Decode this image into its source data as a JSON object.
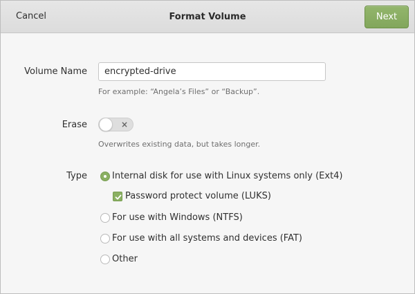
{
  "header": {
    "cancel_label": "Cancel",
    "title": "Format Volume",
    "next_label": "Next",
    "next_color": "#8bb063"
  },
  "volume_name": {
    "label": "Volume Name",
    "value": "encrypted-drive",
    "hint": "For example: “Angela’s Files” or “Backup”."
  },
  "erase": {
    "label": "Erase",
    "enabled": false,
    "off_glyph": "×",
    "hint": "Overwrites existing data, but takes longer."
  },
  "type": {
    "label": "Type",
    "options": [
      {
        "label": "Internal disk for use with Linux systems only (Ext4)",
        "selected": true
      },
      {
        "label": "For use with Windows (NTFS)",
        "selected": false
      },
      {
        "label": "For use with all systems and devices (FAT)",
        "selected": false
      },
      {
        "label": "Other",
        "selected": false
      }
    ],
    "password_protect": {
      "label": "Password protect volume (LUKS)",
      "checked": true
    }
  },
  "accent_color": "#8bb063"
}
